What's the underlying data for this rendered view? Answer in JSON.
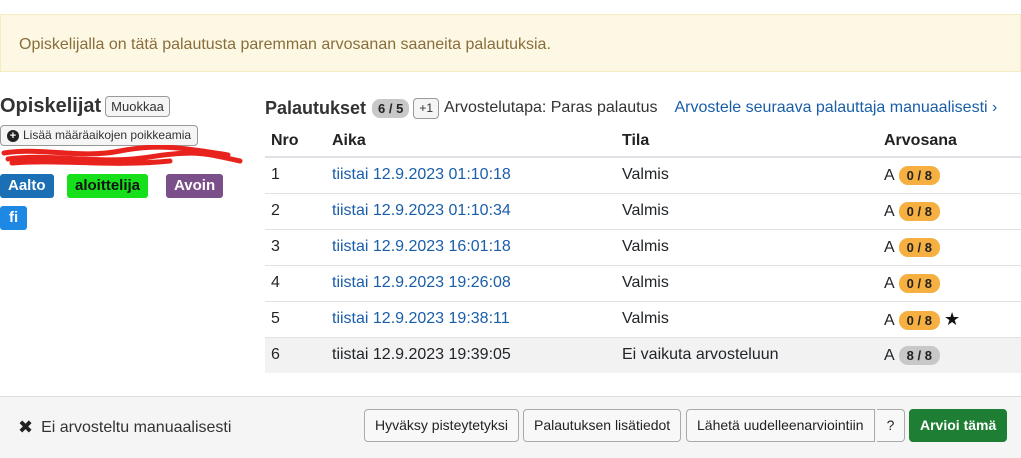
{
  "alert": {
    "text": "Opiskelijalla on tätä palautusta paremman arvosanan saaneita palautuksia."
  },
  "students": {
    "title": "Opiskelijat",
    "edit_label": "Muokkaa",
    "deadline_label": "Lisää määräaikojen poikkeamia",
    "tags": [
      "Aalto",
      "aloittelija",
      "Avoin",
      "fi"
    ]
  },
  "submissions": {
    "title": "Palautukset",
    "count": "6 / 5",
    "plus": "+1",
    "method": "Arvostelutapa: Paras palautus",
    "next_link": "Arvostele seuraava palauttaja manuaalisesti ›",
    "headers": [
      "Nro",
      "Aika",
      "Tila",
      "Arvosana"
    ],
    "rows": [
      {
        "nro": "1",
        "time": "tiistai 12.9.2023 01:10:18",
        "status": "Valmis",
        "grade": "A",
        "score": "0 / 8"
      },
      {
        "nro": "2",
        "time": "tiistai 12.9.2023 01:10:34",
        "status": "Valmis",
        "grade": "A",
        "score": "0 / 8"
      },
      {
        "nro": "3",
        "time": "tiistai 12.9.2023 16:01:18",
        "status": "Valmis",
        "grade": "A",
        "score": "0 / 8"
      },
      {
        "nro": "4",
        "time": "tiistai 12.9.2023 19:26:08",
        "status": "Valmis",
        "grade": "A",
        "score": "0 / 8"
      },
      {
        "nro": "5",
        "time": "tiistai 12.9.2023 19:38:11",
        "status": "Valmis",
        "grade": "A",
        "score": "0 / 8",
        "star": "★"
      },
      {
        "nro": "6",
        "time": "tiistai 12.9.2023 19:39:05",
        "status": "Ei vaikuta arvosteluun",
        "grade": "A",
        "score": "8 / 8"
      }
    ]
  },
  "footer": {
    "status": "Ei arvosteltu manuaalisesti",
    "buttons": {
      "approve": "Hyväksy pisteytetyksi",
      "details": "Palautuksen lisätiedot",
      "resubmit": "Lähetä uudelleenarviointiin",
      "help": "?",
      "grade": "Arvioi tämä"
    }
  },
  "colors": {
    "alert_bg": "#fcf8e3",
    "link": "#1a5ea8",
    "score_zero": "#f6b042",
    "score_full": "#c8c8c8",
    "primary_action": "#1e7e34",
    "tag_aalto": "#1a6fb5",
    "tag_aloittelija": "#15e01a",
    "tag_avoin": "#7b4f8a",
    "tag_fi": "#1e88e5"
  }
}
